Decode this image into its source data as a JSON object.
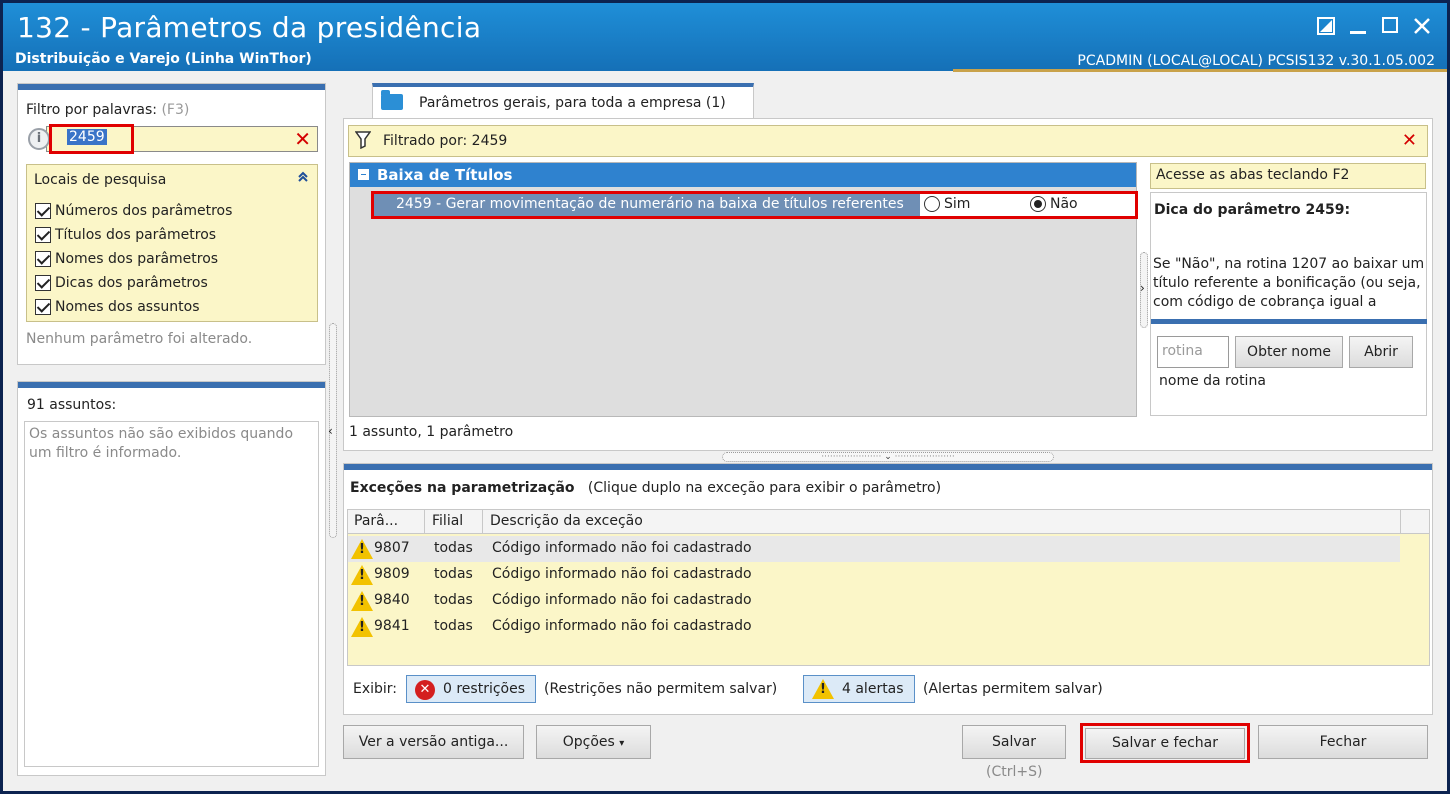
{
  "window": {
    "title": "132 - Parâmetros da presidência",
    "subtitle": "Distribuição e Varejo (Linha WinThor)",
    "user_info": "PCADMIN (LOCAL@LOCAL)   PCSIS132  v.30.1.05.002"
  },
  "filter": {
    "label": "Filtro por palavras:",
    "shortcut": "(F3)",
    "value": "2459",
    "clear_symbol": "✕",
    "search_locations": {
      "title": "Locais de pesquisa",
      "items": [
        {
          "label": "Números dos parâmetros",
          "checked": true
        },
        {
          "label": "Títulos dos parâmetros",
          "checked": true
        },
        {
          "label": "Nomes dos parâmetros",
          "checked": true
        },
        {
          "label": "Dicas dos parâmetros",
          "checked": true
        },
        {
          "label": "Nomes dos assuntos",
          "checked": true
        }
      ]
    },
    "status": "Nenhum parâmetro foi alterado."
  },
  "subjects": {
    "count_label": "91 assuntos:",
    "message": "Os assuntos não são exibidos quando um filtro é informado."
  },
  "tab": {
    "label": "Parâmetros gerais, para toda a empresa  (1)"
  },
  "filtered_bar": {
    "text": "Filtrado por: 2459"
  },
  "group": {
    "title": "Baixa de Títulos",
    "parameter": {
      "text": "2459 - Gerar movimentação de numerário na baixa de títulos referentes",
      "options": [
        {
          "label": "Sim",
          "selected": false
        },
        {
          "label": "Não",
          "selected": true
        }
      ]
    }
  },
  "summary": "1 assunto, 1 parâmetro",
  "tips": {
    "f2_hint": "Acesse as abas teclando F2",
    "title": "Dica do parâmetro 2459:",
    "text": "Se \"Não\", na rotina 1207 ao baixar um título referente a bonificação (ou seja, com código de cobrança igual a",
    "rotina_placeholder": "rotina",
    "get_name_button": "Obter nome",
    "open_button": "Abrir",
    "rotina_name_label": "nome da rotina"
  },
  "exceptions": {
    "title": "Exceções na parametrização",
    "hint": "(Clique duplo na exceção para exibir o parâmetro)",
    "columns": [
      "Parâ...",
      "Filial",
      "Descrição da exceção"
    ],
    "rows": [
      {
        "param": "9807",
        "branch": "todas",
        "description": "Código informado não foi cadastrado"
      },
      {
        "param": "9809",
        "branch": "todas",
        "description": "Código informado não foi cadastrado"
      },
      {
        "param": "9840",
        "branch": "todas",
        "description": "Código informado não foi cadastrado"
      },
      {
        "param": "9841",
        "branch": "todas",
        "description": "Código informado não foi cadastrado"
      }
    ],
    "show_label": "Exibir:",
    "restrictions_button": "0 restrições",
    "restrictions_note": "(Restrições não permitem salvar)",
    "alerts_button": "4 alertas",
    "alerts_note": "(Alertas permitem salvar)"
  },
  "footer": {
    "old_version_button": "Ver a versão antiga...",
    "options_button": "Opções",
    "save_button": "Salvar",
    "save_shortcut": "(Ctrl+S)",
    "save_close_button": "Salvar e fechar",
    "close_button": "Fechar"
  },
  "colors": {
    "title_bar": "#1a7fc8",
    "group_header": "#2f82cf",
    "highlight": "#e00000",
    "tip_yellow": "#fbf6c8"
  }
}
